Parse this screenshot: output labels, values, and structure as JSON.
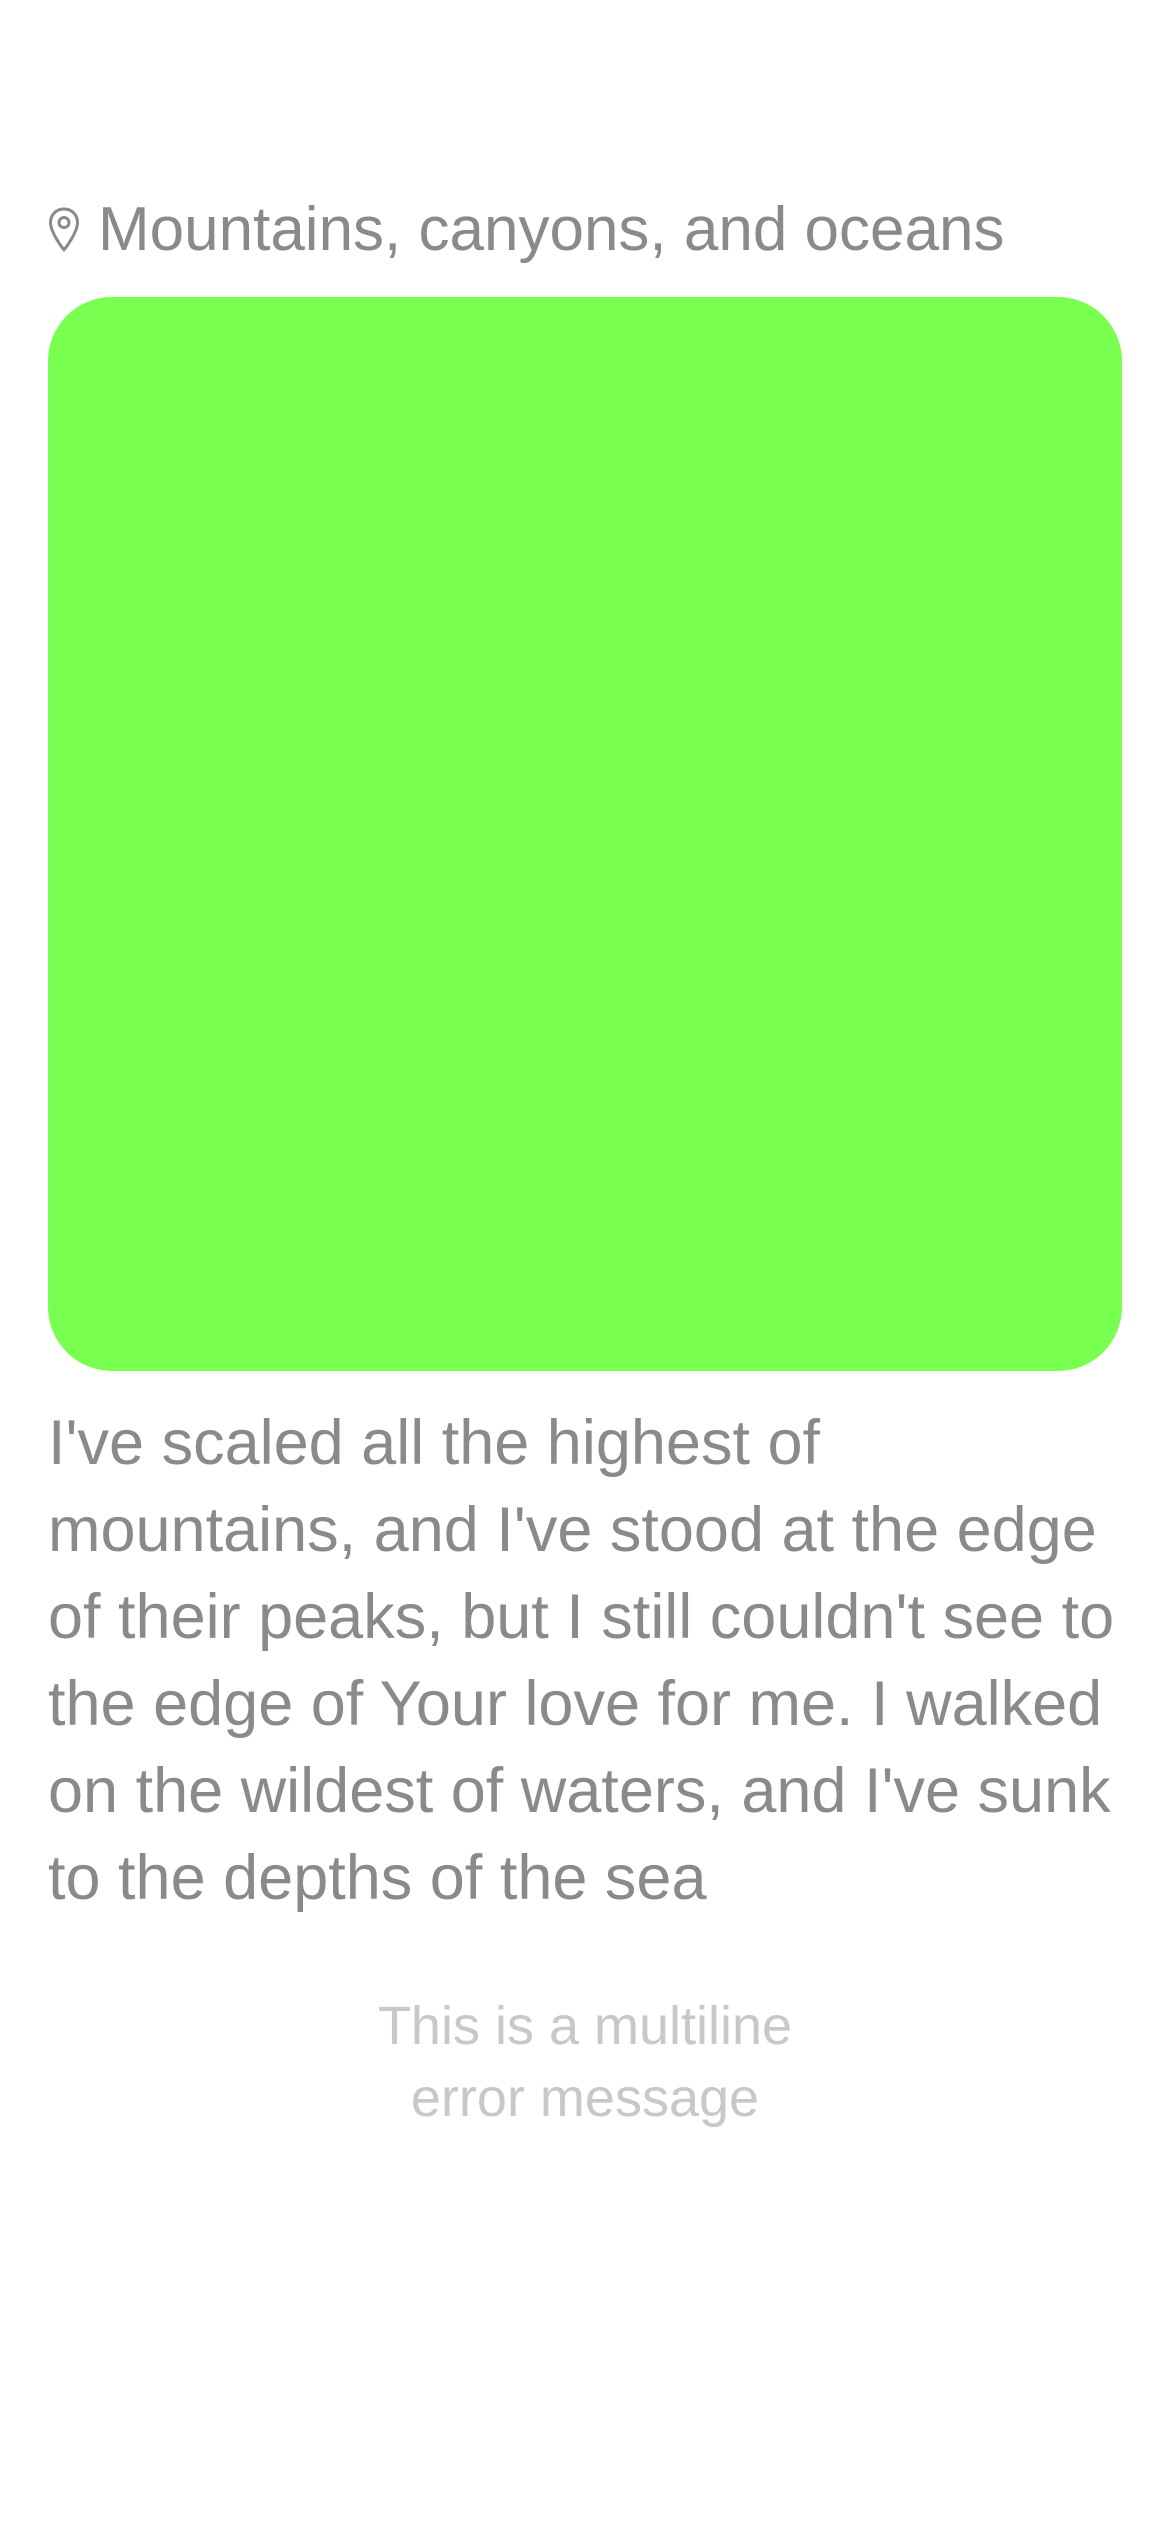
{
  "post": {
    "location_icon": "map-pin-icon",
    "location_title": "Mountains, canyons, and oceans",
    "media_color": "#79ff4f",
    "description": "I've scaled all the highest of mountains, and I've stood at the edge of their peaks, but I still couldn't see to the edge of Your love for me. I walked on the wildest of waters, and I've sunk to the depths of the sea"
  },
  "error": {
    "line1": "This is a multiline",
    "line2": "error message"
  },
  "colors": {
    "text_secondary": "#8a8a8e",
    "text_tertiary": "#c7c7cc"
  }
}
